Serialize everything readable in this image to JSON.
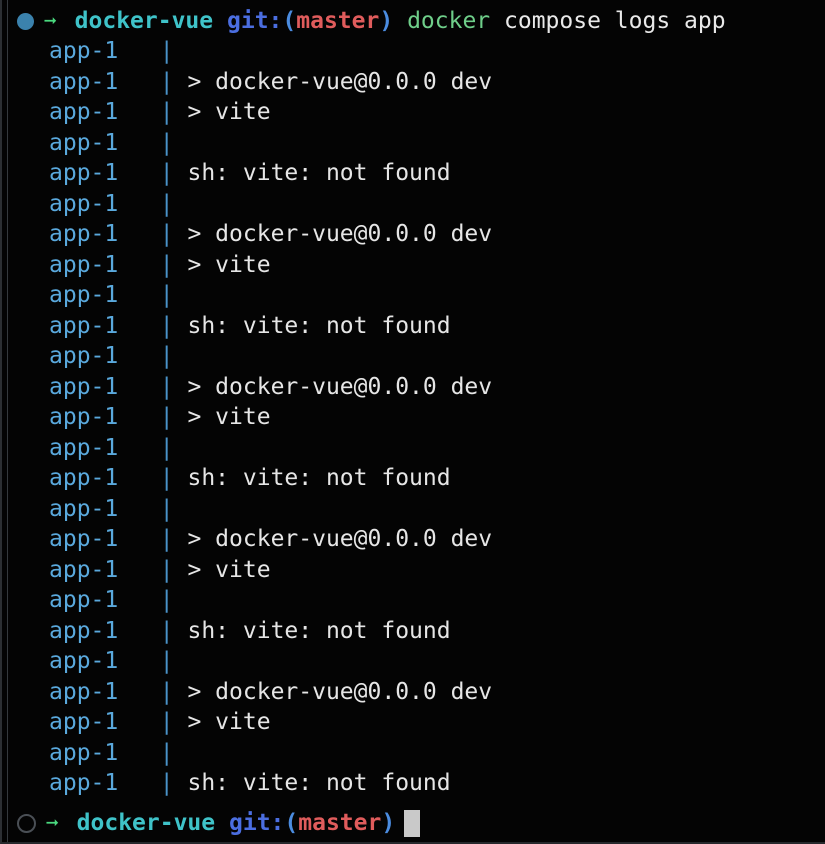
{
  "terminal": {
    "title": "docker compose logs app",
    "colors": {
      "background": "#040404",
      "service_name": "#5aa9dd",
      "pipe": "#4a93c9",
      "stdout": "#e6e6e6",
      "directory": "#3fc3c9",
      "git_label": "#4b6ee0",
      "paren": "#4b8ce0",
      "branch": "#e05c5c",
      "command": "#6fcf8a",
      "arguments": "#e9e9e9",
      "arrow": "#4ad97f",
      "cursor": "#c9c9c9",
      "dot_filled": "#3b82ad",
      "dot_hollow_border": "#4a4f55"
    }
  },
  "prompt_top": {
    "status_icon": "filled-circle-icon",
    "arrow_icon": "arrow-right-icon",
    "directory": "docker-vue",
    "git_label": "git:",
    "paren_open": "(",
    "branch": "master",
    "paren_close": ")",
    "command": "docker",
    "arguments": "compose logs app"
  },
  "prompt_bottom": {
    "status_icon": "hollow-circle-icon",
    "arrow_icon": "arrow-right-icon",
    "directory": "docker-vue",
    "git_label": "git:",
    "paren_open": "(",
    "branch": "master",
    "paren_close": ")",
    "input_value": "",
    "cursor": "block-cursor"
  },
  "log": {
    "service": "app-1",
    "separator": "|",
    "lines": [
      {
        "service": "app-1",
        "separator": "|",
        "text": ""
      },
      {
        "service": "app-1",
        "separator": "|",
        "text": "> docker-vue@0.0.0 dev"
      },
      {
        "service": "app-1",
        "separator": "|",
        "text": "> vite"
      },
      {
        "service": "app-1",
        "separator": "|",
        "text": ""
      },
      {
        "service": "app-1",
        "separator": "|",
        "text": "sh: vite: not found"
      },
      {
        "service": "app-1",
        "separator": "|",
        "text": ""
      },
      {
        "service": "app-1",
        "separator": "|",
        "text": "> docker-vue@0.0.0 dev"
      },
      {
        "service": "app-1",
        "separator": "|",
        "text": "> vite"
      },
      {
        "service": "app-1",
        "separator": "|",
        "text": ""
      },
      {
        "service": "app-1",
        "separator": "|",
        "text": "sh: vite: not found"
      },
      {
        "service": "app-1",
        "separator": "|",
        "text": ""
      },
      {
        "service": "app-1",
        "separator": "|",
        "text": "> docker-vue@0.0.0 dev"
      },
      {
        "service": "app-1",
        "separator": "|",
        "text": "> vite"
      },
      {
        "service": "app-1",
        "separator": "|",
        "text": ""
      },
      {
        "service": "app-1",
        "separator": "|",
        "text": "sh: vite: not found"
      },
      {
        "service": "app-1",
        "separator": "|",
        "text": ""
      },
      {
        "service": "app-1",
        "separator": "|",
        "text": "> docker-vue@0.0.0 dev"
      },
      {
        "service": "app-1",
        "separator": "|",
        "text": "> vite"
      },
      {
        "service": "app-1",
        "separator": "|",
        "text": ""
      },
      {
        "service": "app-1",
        "separator": "|",
        "text": "sh: vite: not found"
      },
      {
        "service": "app-1",
        "separator": "|",
        "text": ""
      },
      {
        "service": "app-1",
        "separator": "|",
        "text": "> docker-vue@0.0.0 dev"
      },
      {
        "service": "app-1",
        "separator": "|",
        "text": "> vite"
      },
      {
        "service": "app-1",
        "separator": "|",
        "text": ""
      },
      {
        "service": "app-1",
        "separator": "|",
        "text": "sh: vite: not found"
      }
    ]
  }
}
